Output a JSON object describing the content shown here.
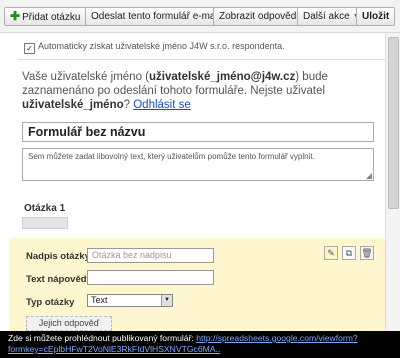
{
  "toolbar": {
    "add_question": "Přidat otázku",
    "send_form": "Odeslat tento formulář e-mailem",
    "show_responses": "Zobrazit odpovědi",
    "more_actions": "Další akce",
    "save": "Uložit"
  },
  "form": {
    "auto_username_label": "Automaticky získat uživatelské jméno J4W s.r.o. respondenta.",
    "user_notice_prefix": "Vaše uživatelské jméno (",
    "user_email": "uživatelské_jméno@j4w.cz",
    "user_notice_middle": ") bude zaznamenáno po odeslání tohoto formuláře. Nejste uživatel ",
    "user_name": "uživatelské_jméno",
    "user_notice_suffix": "? ",
    "logout_link": "Odhlásit se",
    "title": "Formulář bez názvu",
    "description_placeholder": "Sem můžete zadat libovolný text, který uživatelům pomůže tento formulář vyplnit."
  },
  "question": {
    "label": "Otázka 1",
    "title_label": "Nadpis otázky",
    "title_placeholder": "Otázka bez nadpisu",
    "help_label": "Text nápovědy",
    "type_label": "Typ otázky",
    "type_value": "Text",
    "choice_button": "Jejich odpověď"
  },
  "notification": {
    "text": "Zde si můžete prohlédnout publikovaný formulář: ",
    "url": "http://spreadsheets.google.com/viewform?formkey=cEplbHFwT2VoNlE3RkFIdVlHSXNVTGc6MA.."
  }
}
